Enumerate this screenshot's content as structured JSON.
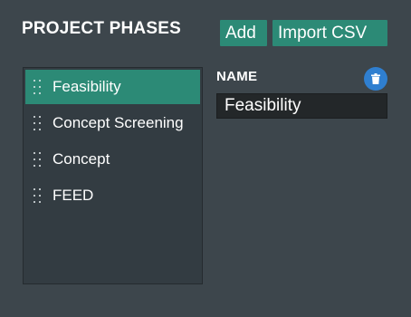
{
  "panel": {
    "title": "PROJECT PHASES",
    "buttons": {
      "add_label": "Add",
      "import_label": "Import CSV"
    }
  },
  "phases": {
    "items": [
      {
        "label": "Feasibility",
        "selected": true
      },
      {
        "label": "Concept Screening",
        "selected": false
      },
      {
        "label": "Concept",
        "selected": false
      },
      {
        "label": "FEED",
        "selected": false
      }
    ]
  },
  "editor": {
    "name_label": "NAME",
    "name_value": "Feasibility",
    "delete_icon": "trash-icon"
  },
  "colors": {
    "background": "#3d464c",
    "list_background": "#333c42",
    "accent": "#2c8a76",
    "delete_button": "#2f7fd0",
    "input_background": "#232729"
  }
}
